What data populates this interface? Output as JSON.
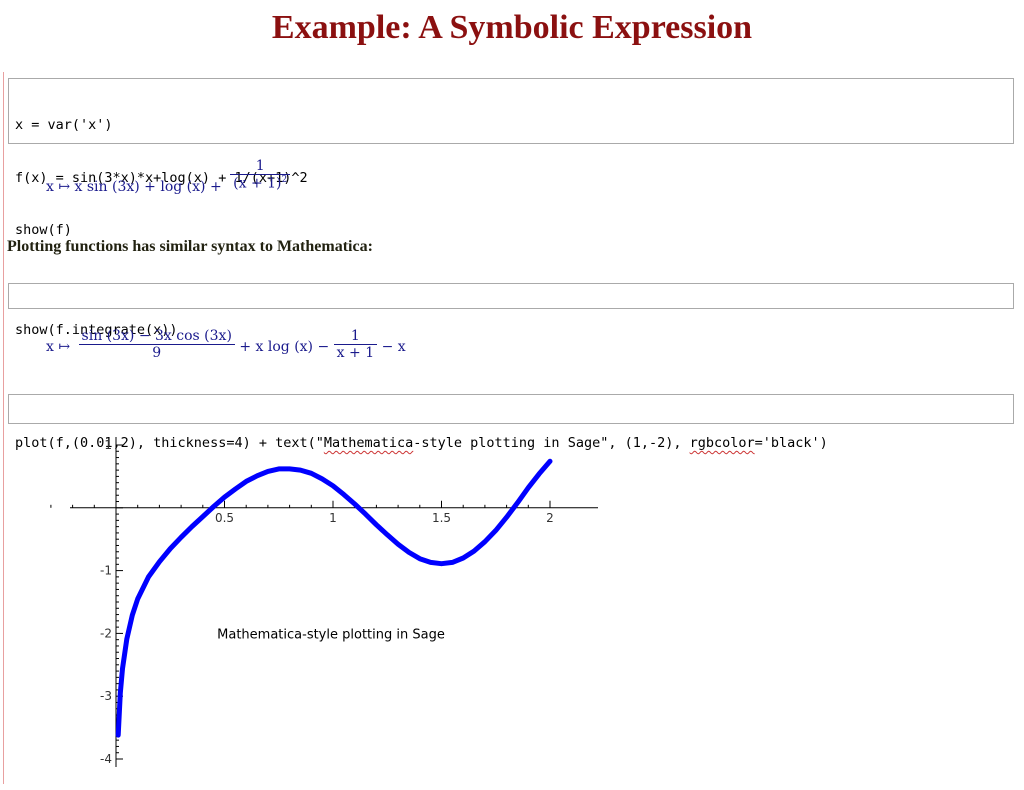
{
  "page": {
    "title": "Example: A Symbolic Expression",
    "note": "Plotting functions has similar syntax to Mathematica:"
  },
  "cell1": {
    "lines": [
      "x = var('x')",
      "f(x) = sin(3*x)*x+log(x) + 1/(x+1)^2",
      "show(f)"
    ]
  },
  "output1": {
    "lhs": "x ↦ x sin (3x) + log (x) +",
    "num": "1",
    "den": "(x + 1)",
    "den_exp": "2"
  },
  "cell2": {
    "lines": [
      "show(f.integrate(x))"
    ]
  },
  "output2": {
    "prefix": "x ↦",
    "frac1_num": "sin (3x) − 3x cos (3x)",
    "frac1_den": "9",
    "middle": "+ x log (x) −",
    "frac2_num": "1",
    "frac2_den": "x + 1",
    "suffix": "− x"
  },
  "cell3": {
    "code_pre": "plot(f,(0.01,2), thickness=4) + text(\"",
    "code_word1": "Mathematica",
    "code_mid": "-style plotting in Sage\", (1,-2), ",
    "code_word2": "rgbcolor",
    "code_post": "='black')"
  },
  "chart_data": {
    "type": "line",
    "function": "sin(3*x)*x+log(x) + 1/(x+1)^2",
    "xlim": [
      0.01,
      2
    ],
    "ylim": [
      -4,
      1
    ],
    "x_ticks": [
      "0.5",
      "1",
      "1.5",
      "2"
    ],
    "y_ticks": [
      "1",
      "-1",
      "-2",
      "-3",
      "-4"
    ],
    "line_color": "#0000ff",
    "thickness": 4,
    "annotation": {
      "text": "Mathematica-style plotting in Sage",
      "x": 1,
      "y": -2,
      "color": "#000000"
    },
    "series": [
      {
        "x": [
          0.01,
          0.02,
          0.03,
          0.05,
          0.075,
          0.1,
          0.15,
          0.2,
          0.25,
          0.3,
          0.35,
          0.4,
          0.45,
          0.5,
          0.55,
          0.6,
          0.65,
          0.7,
          0.75,
          0.8,
          0.85,
          0.9,
          0.95,
          1.0,
          1.05,
          1.1,
          1.15,
          1.2,
          1.25,
          1.3,
          1.35,
          1.4,
          1.45,
          1.5,
          1.55,
          1.6,
          1.65,
          1.7,
          1.75,
          1.8,
          1.85,
          1.9,
          1.95,
          2.0
        ],
        "y": [
          -3.62,
          -2.95,
          -2.56,
          -2.09,
          -1.71,
          -1.45,
          -1.1,
          -0.86,
          -0.65,
          -0.47,
          -0.3,
          -0.14,
          0.02,
          0.17,
          0.3,
          0.42,
          0.51,
          0.58,
          0.62,
          0.62,
          0.6,
          0.55,
          0.46,
          0.35,
          0.21,
          0.06,
          -0.1,
          -0.27,
          -0.43,
          -0.58,
          -0.71,
          -0.81,
          -0.87,
          -0.89,
          -0.87,
          -0.8,
          -0.69,
          -0.54,
          -0.36,
          -0.15,
          0.08,
          0.32,
          0.54,
          0.74
        ]
      }
    ]
  }
}
